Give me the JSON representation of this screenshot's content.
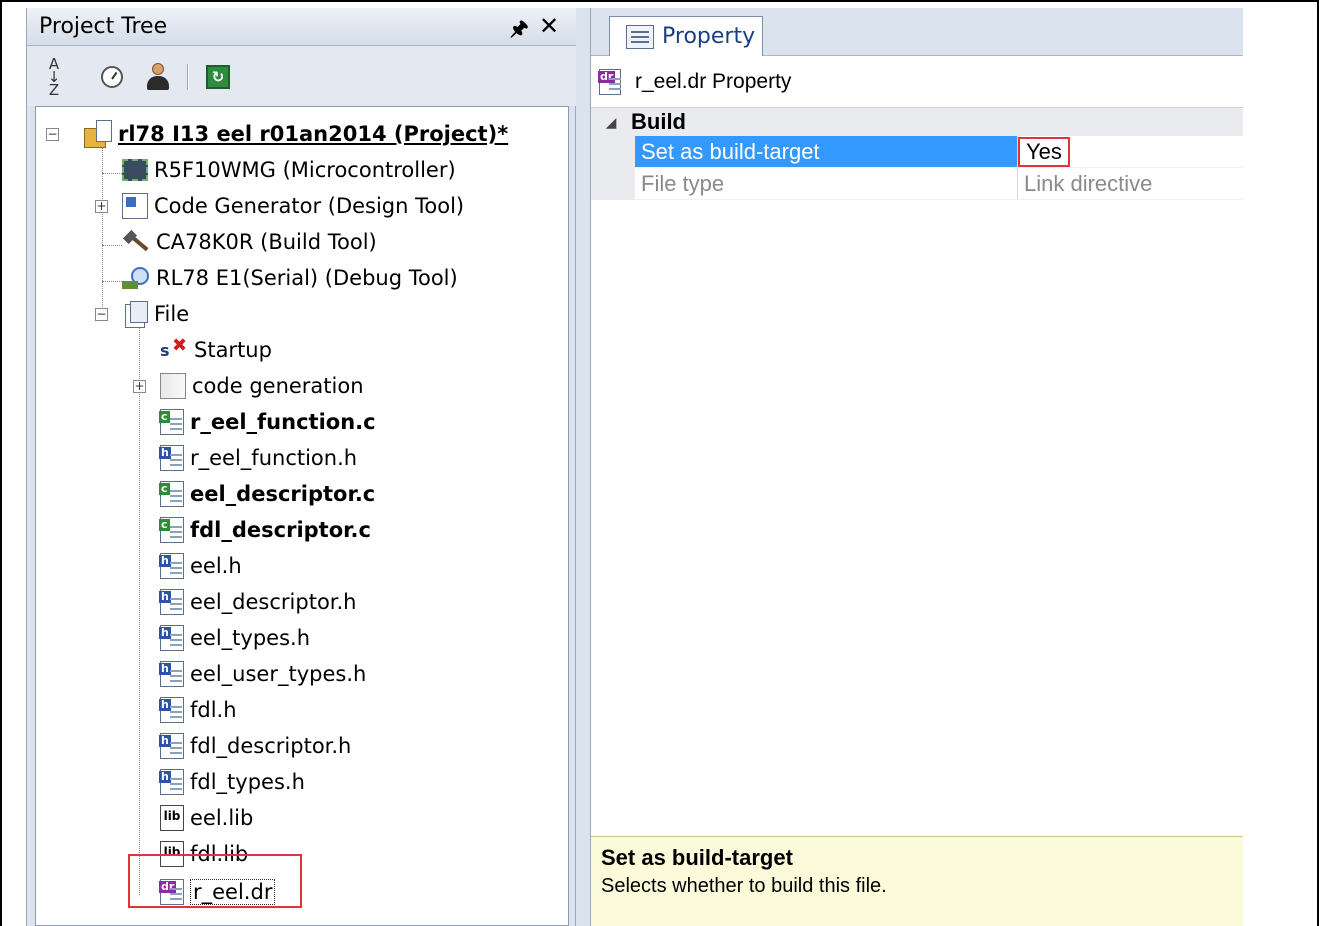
{
  "project_tree": {
    "title": "Project Tree",
    "pin_glyph": "↑",
    "close_glyph": "✕",
    "toolbar": {
      "sort_icon": "sort-az-icon",
      "history_icon": "clock-icon",
      "user_icon": "user-icon",
      "refresh_icon": "refresh-icon",
      "refresh_glyph": "↻"
    },
    "root_label": "rl78 I13 eel r01an2014 (Project)*",
    "items": [
      {
        "label": "R5F10WMG (Microcontroller)",
        "icon": "microcontroller-icon"
      },
      {
        "label": "Code Generator (Design Tool)",
        "icon": "code-generator-icon"
      },
      {
        "label": "CA78K0R (Build Tool)",
        "icon": "hammer-icon"
      },
      {
        "label": "RL78 E1(Serial) (Debug Tool)",
        "icon": "debug-tool-icon"
      },
      {
        "label": "File",
        "icon": "file-folder-icon"
      }
    ],
    "file_items": [
      {
        "label": "Startup",
        "icon": "startup-icon"
      },
      {
        "label": "code generation",
        "icon": "folder-icon"
      },
      {
        "label": "r_eel_function.c",
        "icon": "c-file-icon",
        "bold": true
      },
      {
        "label": "r_eel_function.h",
        "icon": "h-file-icon"
      },
      {
        "label": "eel_descriptor.c",
        "icon": "c-file-icon",
        "bold": true
      },
      {
        "label": "fdl_descriptor.c",
        "icon": "c-file-icon",
        "bold": true
      },
      {
        "label": "eel.h",
        "icon": "h-file-icon"
      },
      {
        "label": "eel_descriptor.h",
        "icon": "h-file-icon"
      },
      {
        "label": "eel_types.h",
        "icon": "h-file-icon"
      },
      {
        "label": "eel_user_types.h",
        "icon": "h-file-icon"
      },
      {
        "label": "fdl.h",
        "icon": "h-file-icon"
      },
      {
        "label": "fdl_descriptor.h",
        "icon": "h-file-icon"
      },
      {
        "label": "fdl_types.h",
        "icon": "h-file-icon"
      },
      {
        "label": "eel.lib",
        "icon": "lib-file-icon"
      },
      {
        "label": "fdl.lib",
        "icon": "lib-file-icon"
      },
      {
        "label": "r_eel.dr",
        "icon": "dr-file-icon",
        "selected": true
      }
    ],
    "icon_tags": {
      "c": "c",
      "h": "h",
      "dr": "dr",
      "lib": "lib",
      "startup_s": "s",
      "startup_x": "✖"
    },
    "expander_plus": "+",
    "expander_minus": "−"
  },
  "property_panel": {
    "tab_label": "Property",
    "header_text": "r_eel.dr Property",
    "category": {
      "label": "Build",
      "collapse_glyph": "◢"
    },
    "rows": [
      {
        "name": "Set as build-target",
        "value": "Yes",
        "selected": true
      },
      {
        "name": "File type",
        "value": "Link directive",
        "disabled": true
      }
    ],
    "description": {
      "title": "Set as build-target",
      "text": "Selects whether to build this file."
    }
  },
  "colors": {
    "selection_blue": "#3399ff",
    "highlight_red": "#e0343a",
    "panel_bg": "#dbe3ef",
    "description_bg": "#fbfbdc"
  }
}
